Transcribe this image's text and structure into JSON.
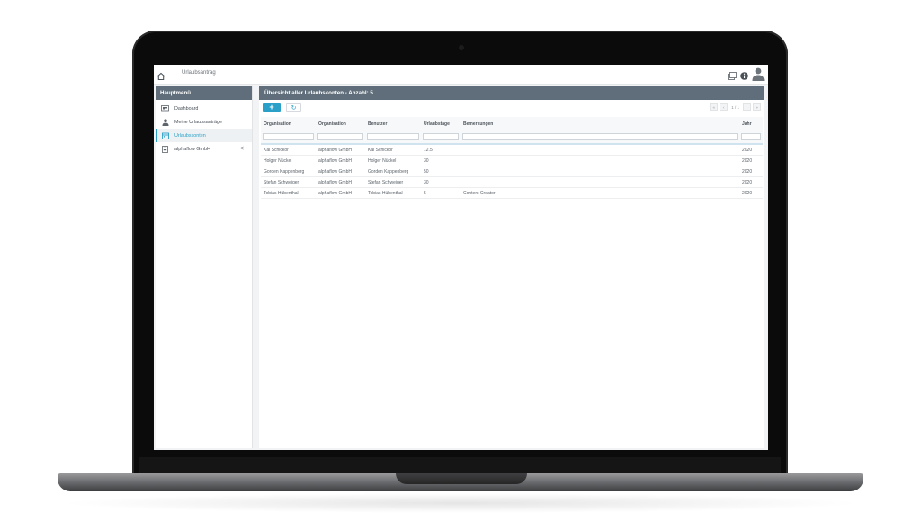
{
  "app": {
    "breadcrumb": "Urlaubsantrag",
    "icons": {
      "home": "home-icon",
      "window": "window-icon",
      "info": "info-icon",
      "user": "user-avatar-icon"
    }
  },
  "sidebar": {
    "title": "Hauptmenü",
    "items": [
      {
        "label": "Dashboard",
        "icon": "dashboard-icon",
        "active": false
      },
      {
        "label": "Meine Urlaubsanträge",
        "icon": "person-icon",
        "active": false
      },
      {
        "label": "Urlaubskonten",
        "icon": "calendar-icon",
        "active": true
      },
      {
        "label": "alphaflow GmbH",
        "icon": "building-icon",
        "active": false,
        "chevron": "<"
      }
    ]
  },
  "main": {
    "title": "Übersicht aller Urlaubskonten - Anzahl: 5",
    "toolbar": {
      "add_label": "+",
      "refresh_label": "↻"
    },
    "pager": {
      "first": "«",
      "prev": "‹",
      "info": "1 / 1",
      "next": "›",
      "last": "»"
    },
    "table": {
      "columns": [
        "Organisation",
        "Organisation",
        "Benutzer",
        "Urlaubstage",
        "Bemerkungen",
        "Jahr"
      ],
      "rows": [
        [
          "Kai Schickor",
          "alphaflow GmbH",
          "Kai Schickor",
          "12.5",
          "",
          "2020"
        ],
        [
          "Holger Nückel",
          "alphaflow GmbH",
          "Holger Nückel",
          "30",
          "",
          "2020"
        ],
        [
          "Gorden Kappenberg",
          "alphaflow GmbH",
          "Gorden Kappenberg",
          "50",
          "",
          "2020"
        ],
        [
          "Stefan Schweiger",
          "alphaflow GmbH",
          "Stefan Schweiger",
          "30",
          "",
          "2020"
        ],
        [
          "Tobias Hübenthal",
          "alphaflow GmbH",
          "Tobias Hübenthal",
          "5",
          "Content Creator",
          "2020"
        ]
      ]
    }
  },
  "colors": {
    "accent": "#2aa0c8",
    "panel_header": "#5f6e7a"
  }
}
